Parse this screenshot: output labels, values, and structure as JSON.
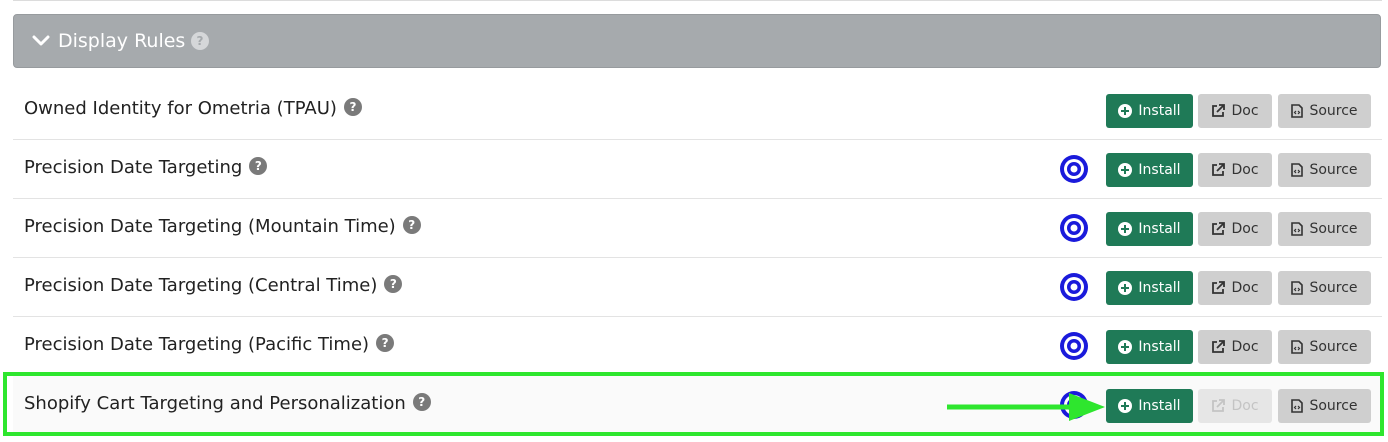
{
  "section": {
    "title": "Display Rules",
    "help_label": "?"
  },
  "rows": [
    {
      "name": "Owned Identity for Ometria (TPAU)",
      "help": "?",
      "has_target": false,
      "doc_disabled": false
    },
    {
      "name": "Precision Date Targeting",
      "help": "?",
      "has_target": true,
      "doc_disabled": false
    },
    {
      "name": "Precision Date Targeting (Mountain Time)",
      "help": "?",
      "has_target": true,
      "doc_disabled": false
    },
    {
      "name": "Precision Date Targeting (Central Time)",
      "help": "?",
      "has_target": true,
      "doc_disabled": false
    },
    {
      "name": "Precision Date Targeting (Pacific Time)",
      "help": "?",
      "has_target": true,
      "doc_disabled": false
    },
    {
      "name": "Shopify Cart Targeting and Personalization",
      "help": "?",
      "has_target": true,
      "doc_disabled": true
    }
  ],
  "buttons": {
    "install": "Install",
    "doc": "Doc",
    "source": "Source"
  },
  "colors": {
    "install_bg": "#1f7a57",
    "secondary_bg": "#cfcfcf",
    "header_bg": "#a6aaad",
    "highlight": "#2ee62e",
    "target_icon": "#1a1adb"
  },
  "icons": {
    "header": "chevron-down-icon",
    "help": "question-circle-icon",
    "target": "bullseye-icon",
    "install": "plus-circle-icon",
    "doc": "external-link-icon",
    "source": "file-code-icon"
  }
}
